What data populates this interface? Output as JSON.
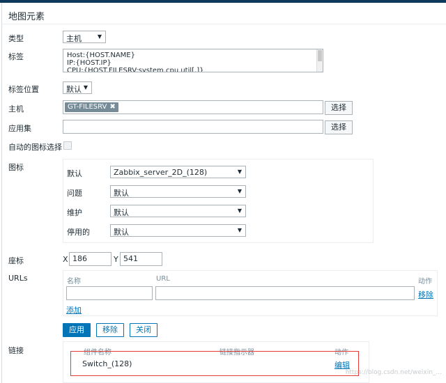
{
  "dialog": {
    "title": "地图元素"
  },
  "form": {
    "type": {
      "label": "类型",
      "value": "主机"
    },
    "tag": {
      "label": "标签",
      "lines": [
        "Host:{HOST.NAME}",
        "IP:{HOST.IP}",
        "CPU:{HOST.FILESRV:system.cpu.util[,]}"
      ]
    },
    "tag_position": {
      "label": "标签位置",
      "value": "默认"
    },
    "host": {
      "label": "主机",
      "tag": "GT-FILESRV",
      "select_label": "选择"
    },
    "application": {
      "label": "应用集",
      "value": "",
      "select_label": "选择"
    },
    "auto_icon": {
      "label": "自动的图标选择"
    },
    "icons": {
      "label": "图标",
      "rows": [
        {
          "label": "默认",
          "value": "Zabbix_server_2D_(128)"
        },
        {
          "label": "问题",
          "value": "默认"
        },
        {
          "label": "维护",
          "value": "默认"
        },
        {
          "label": "停用的",
          "value": "默认"
        }
      ]
    },
    "coords": {
      "label": "座标",
      "x_label": "X",
      "x_value": "186",
      "y_label": "Y",
      "y_value": "541"
    },
    "urls": {
      "label": "URLs",
      "col_name": "名称",
      "col_url": "URL",
      "col_action": "动作",
      "remove_label": "移除",
      "add_label": "添加"
    },
    "buttons": {
      "apply": "应用",
      "remove": "移除",
      "close": "关闭"
    },
    "links": {
      "label": "链接",
      "col_element": "组件名称",
      "col_indicator": "链接指示器",
      "col_action": "动作",
      "rows": [
        {
          "element": "Switch_(128)",
          "action": "编辑"
        }
      ]
    }
  },
  "watermark": "https://blog.csdn.net/weixin_..."
}
